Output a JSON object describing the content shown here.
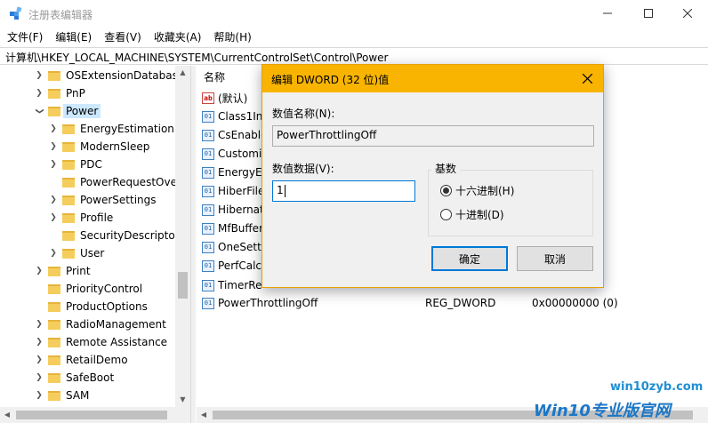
{
  "window": {
    "title": "注册表编辑器",
    "min_glyph": "—",
    "max_glyph": "☐",
    "close_glyph": "✕"
  },
  "menu": {
    "items": [
      "文件(F)",
      "编辑(E)",
      "查看(V)",
      "收藏夹(A)",
      "帮助(H)"
    ]
  },
  "address": {
    "path": "计算机\\HKEY_LOCAL_MACHINE\\SYSTEM\\CurrentControlSet\\Control\\Power"
  },
  "tree": {
    "items": [
      {
        "label": "OSExtensionDatabase"
      },
      {
        "label": "PnP"
      },
      {
        "label": "Power"
      },
      {
        "label": "EnergyEstimation"
      },
      {
        "label": "ModernSleep"
      },
      {
        "label": "PDC"
      },
      {
        "label": "PowerRequestOve"
      },
      {
        "label": "PowerSettings"
      },
      {
        "label": "Profile"
      },
      {
        "label": "SecurityDescriptor"
      },
      {
        "label": "User"
      },
      {
        "label": "Print"
      },
      {
        "label": "PriorityControl"
      },
      {
        "label": "ProductOptions"
      },
      {
        "label": "RadioManagement"
      },
      {
        "label": "Remote Assistance"
      },
      {
        "label": "RetailDemo"
      },
      {
        "label": "SafeBoot"
      },
      {
        "label": "SAM"
      }
    ]
  },
  "values_pane": {
    "column_name": "名称",
    "rows": [
      {
        "icon": "ab",
        "name": "(默认)",
        "type": "",
        "data": ""
      },
      {
        "icon": "bin",
        "name": "Class1In",
        "type": "",
        "data": ""
      },
      {
        "icon": "bin",
        "name": "CsEnable",
        "type": "",
        "data": ""
      },
      {
        "icon": "bin",
        "name": "Customiz",
        "type": "",
        "data": ""
      },
      {
        "icon": "bin",
        "name": "EnergyEs",
        "type": "",
        "data": ""
      },
      {
        "icon": "bin",
        "name": "HiberFile",
        "type": "",
        "data": ""
      },
      {
        "icon": "bin",
        "name": "Hibernat",
        "type": "",
        "data": ""
      },
      {
        "icon": "bin",
        "name": "MfBuffer",
        "type": "",
        "data": ""
      },
      {
        "icon": "bin",
        "name": "OneSetti",
        "type": "",
        "data": ""
      },
      {
        "icon": "bin",
        "name": "PerfCalc",
        "type": "",
        "data": ""
      },
      {
        "icon": "bin",
        "name": "TimerRe",
        "type": "",
        "data": ""
      },
      {
        "icon": "bin",
        "name": "PowerThrottlingOff",
        "type": "REG_DWORD",
        "data": "0x00000000 (0)"
      }
    ]
  },
  "dialog": {
    "title": "编辑 DWORD (32 位)值",
    "name_label": "数值名称(N):",
    "name_value": "PowerThrottlingOff",
    "data_label": "数值数据(V):",
    "data_value": "1",
    "base_label": "基数",
    "hex_label": "十六进制(H)",
    "dec_label": "十进制(D)",
    "hex_selected": true,
    "ok_label": "确定",
    "cancel_label": "取消",
    "close_glyph": "✕"
  },
  "watermark": {
    "url": "win10zyb.com",
    "brand": "Win10专业版官网"
  }
}
